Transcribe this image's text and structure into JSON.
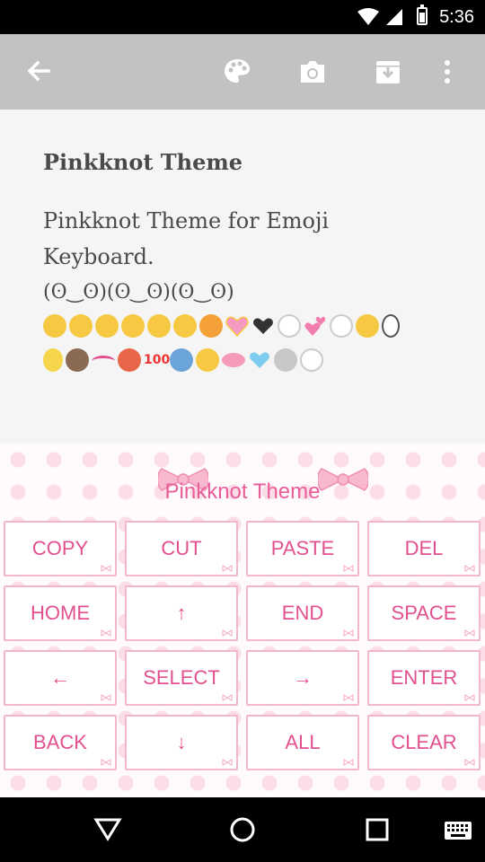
{
  "status_bar": {
    "time": "5:36"
  },
  "toolbar": {
    "icons": [
      "back-arrow-icon",
      "palette-icon",
      "camera-icon",
      "archive-icon",
      "more-vert-icon"
    ],
    "color": "#c2c2c2"
  },
  "content": {
    "title": "Pinkknot Theme",
    "description_line1": "Pinkknot Theme for Emoji",
    "description_line2": "Keyboard.",
    "kaomoji": "(ʘ‿ʘ)(ʘ‿ʘ)(ʘ‿ʘ)"
  },
  "keyboard": {
    "title": "Pinkknot Theme",
    "accent": "#e2508f",
    "keys": [
      [
        "COPY",
        "CUT",
        "PASTE",
        "DEL"
      ],
      [
        "HOME",
        "↑",
        "END",
        "SPACE"
      ],
      [
        "←",
        "SELECT",
        "→",
        "ENTER"
      ],
      [
        "BACK",
        "↓",
        "ALL",
        "CLEAR"
      ]
    ]
  },
  "nav_bar": {
    "icons": [
      "back-triangle-icon",
      "home-circle-icon",
      "recents-square-icon",
      "keyboard-icon"
    ]
  }
}
